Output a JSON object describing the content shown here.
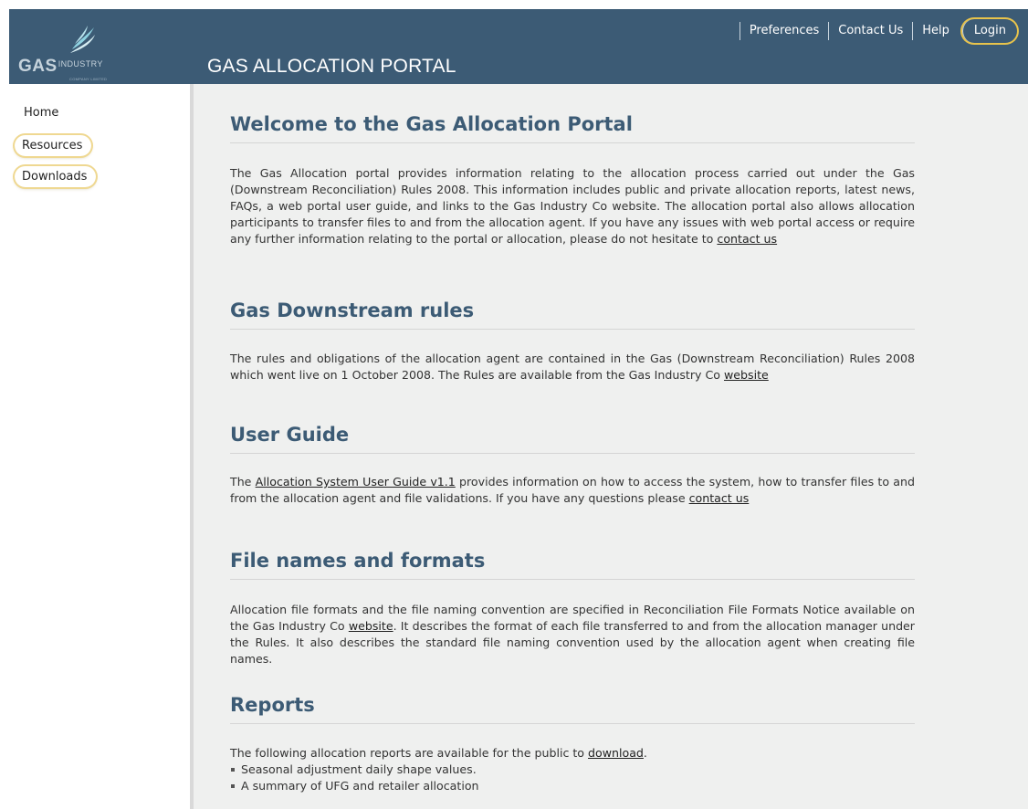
{
  "header": {
    "logo_gas": "GAS",
    "logo_industry": "INDUSTRY",
    "logo_company": "COMPANY LIMITED",
    "title": "GAS ALLOCATION PORTAL",
    "nav": {
      "preferences": "Preferences",
      "contact": "Contact Us",
      "help": "Help",
      "login": "Login"
    }
  },
  "sidebar": {
    "items": [
      {
        "label": "Home"
      },
      {
        "label": "Resources"
      },
      {
        "label": "Downloads"
      }
    ]
  },
  "main": {
    "welcome": {
      "heading": "Welcome to the Gas Allocation Portal",
      "text": "The Gas Allocation portal provides information relating to the allocation process carried out under the Gas (Downstream Reconciliation) Rules 2008. This information includes public and private allocation reports, latest news, FAQs, a web portal user guide, and links to the Gas Industry Co website. The allocation portal also allows allocation participants to transfer files to and from the allocation agent. If you have any issues with web portal access or require any further information relating to the portal or allocation, please do not hesitate to ",
      "link": "contact us"
    },
    "rules": {
      "heading": "Gas Downstream rules",
      "text": "The rules and obligations of the allocation agent are contained in the Gas (Downstream Reconciliation) Rules 2008 which went live on 1 October 2008. The Rules are available from the Gas Industry Co ",
      "link": "website"
    },
    "guide": {
      "heading": "User Guide",
      "text_before": "The ",
      "link": "Allocation System User Guide v1.1",
      "text_after": " provides information on how to access the system, how to transfer files to and from the allocation agent and file validations. If you have any questions please ",
      "link2": "contact us"
    },
    "formats": {
      "heading": "File names and formats",
      "text_before": "Allocation file formats and the file naming convention are specified in Reconciliation File Formats Notice available on the Gas Industry Co ",
      "link": "website",
      "text_after": ". It describes the format of each file transferred to and from the allocation manager under the Rules. It also describes the standard file naming convention used by the allocation agent when creating file names."
    },
    "reports": {
      "heading": "Reports",
      "text": "The following allocation reports are available for the public to ",
      "link": "download",
      "text_end": ".",
      "items": [
        "Seasonal adjustment daily shape values.",
        "A summary of UFG and retailer allocation"
      ]
    }
  }
}
